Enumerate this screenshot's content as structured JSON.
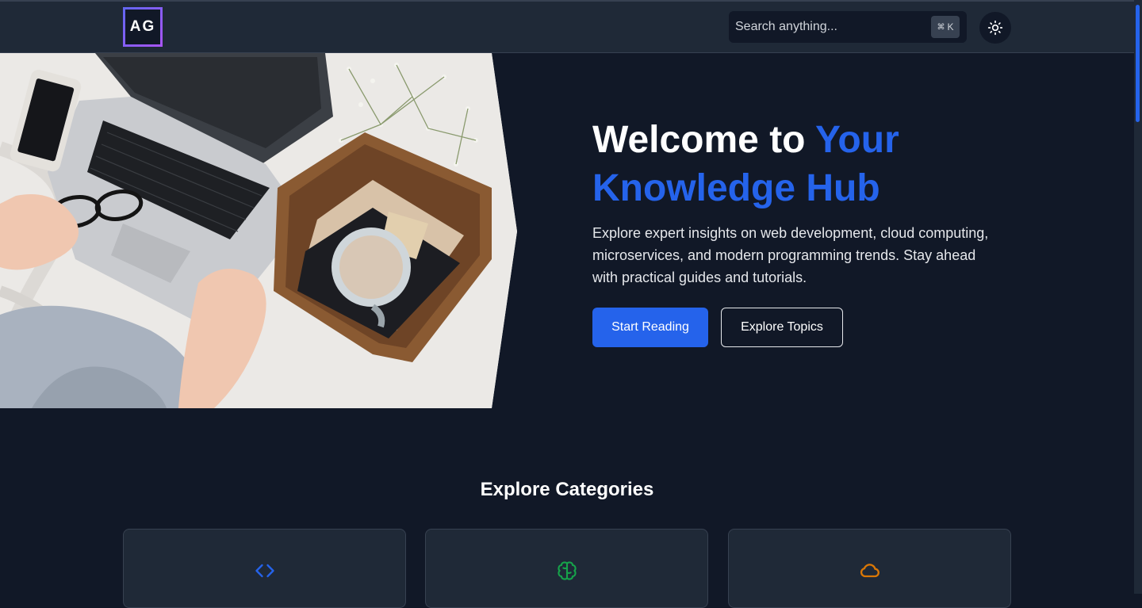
{
  "header": {
    "logo_text": "AG",
    "search_placeholder": "Search anything...",
    "shortcut_symbol": "⌘",
    "shortcut_key": "K"
  },
  "hero": {
    "title_prefix": "Welcome to ",
    "title_accent": "Your Knowledge Hub",
    "description": "Explore expert insights on web development, cloud computing, microservices, and modern programming trends. Stay ahead with practical guides and tutorials.",
    "primary_button": "Start Reading",
    "secondary_button": "Explore Topics"
  },
  "categories": {
    "heading": "Explore Categories",
    "cards": [
      {
        "icon": "code-icon",
        "color": "#2563eb"
      },
      {
        "icon": "brain-icon",
        "color": "#16a34a"
      },
      {
        "icon": "cloud-icon",
        "color": "#d97706"
      }
    ]
  },
  "colors": {
    "accent": "#2563eb",
    "background": "#111827",
    "surface": "#1f2937"
  }
}
